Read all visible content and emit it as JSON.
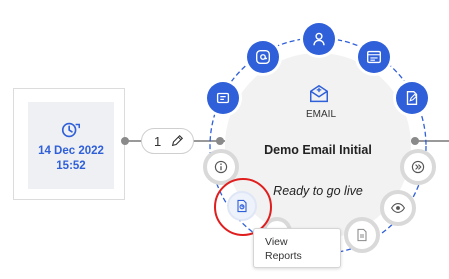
{
  "date_card": {
    "date": "14 Dec 2022",
    "time": "15:52"
  },
  "connector": {
    "step_number": "1"
  },
  "node": {
    "channel_label": "EMAIL",
    "title": "Demo Email Initial",
    "status": "Ready to go live"
  },
  "tooltip": {
    "line1": "View",
    "line2": "Reports"
  },
  "colors": {
    "accent": "#2f5fd9",
    "highlight": "#e01e1e"
  }
}
